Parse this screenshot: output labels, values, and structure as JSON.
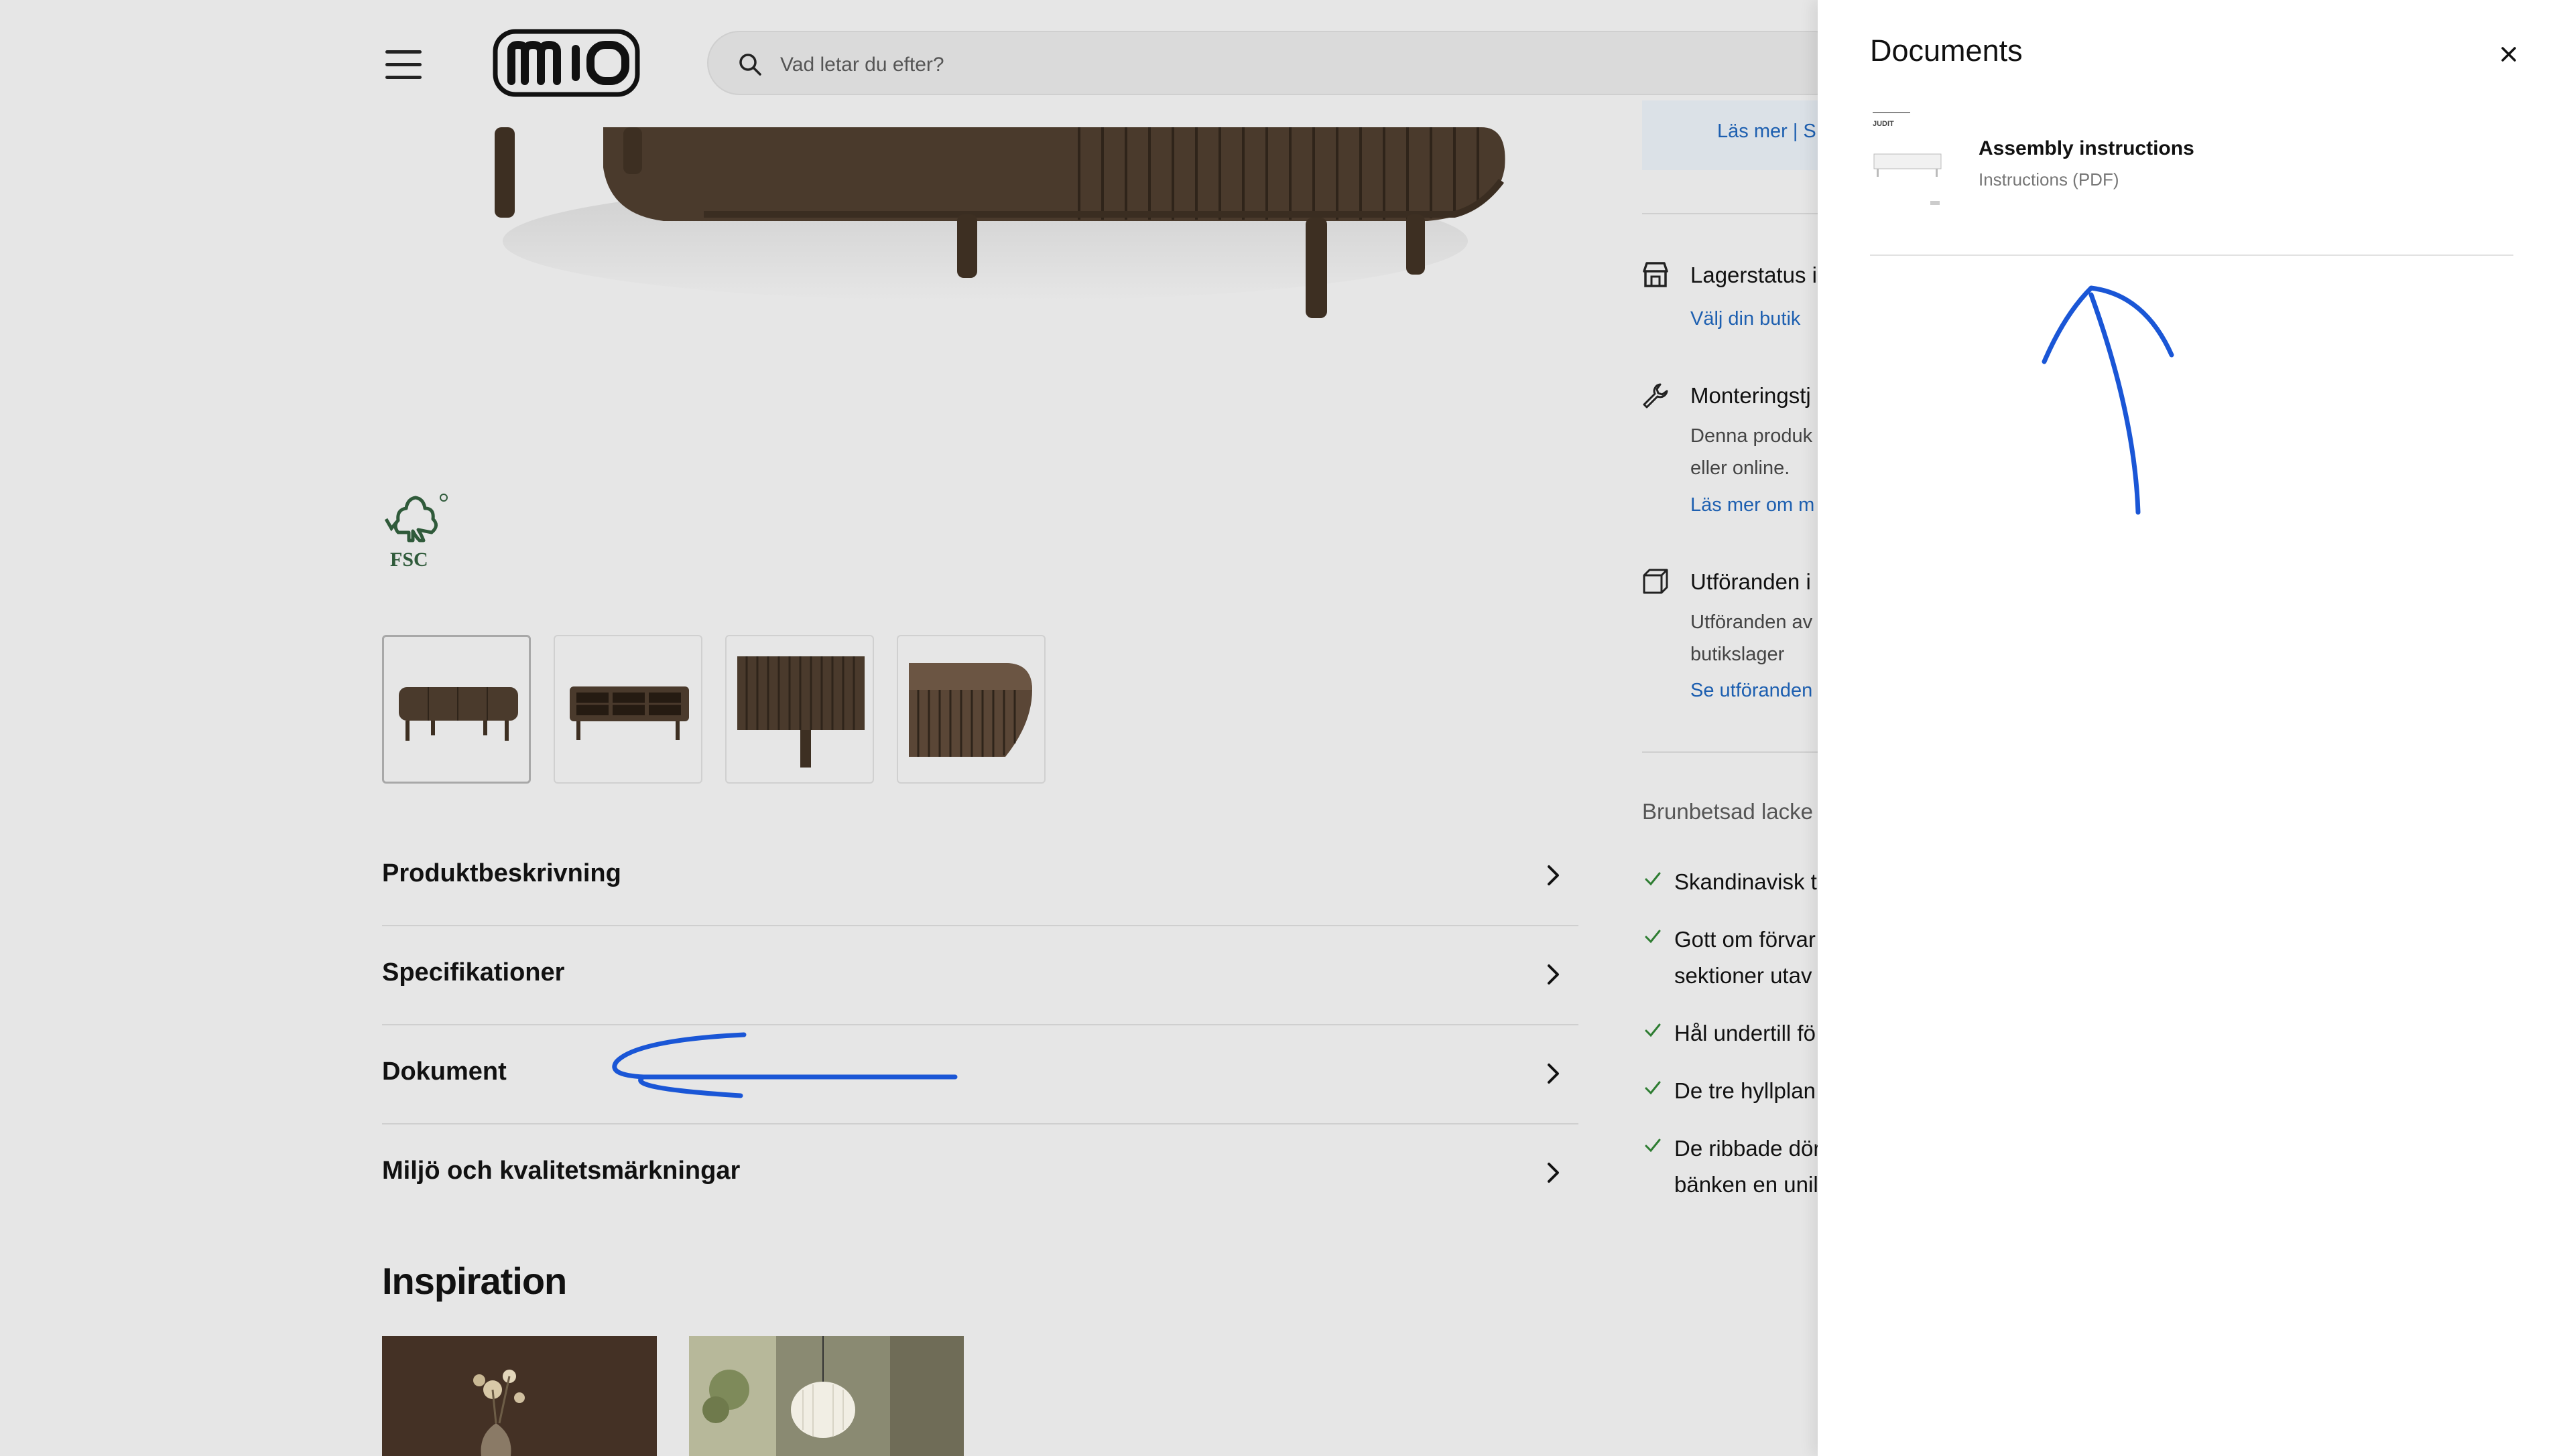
{
  "header": {
    "search_placeholder": "Vad letar du efter?"
  },
  "gallery": {
    "thumbnails": [
      {
        "label": "sideboard-front"
      },
      {
        "label": "sideboard-open"
      },
      {
        "label": "sideboard-detail"
      },
      {
        "label": "sideboard-corner"
      }
    ]
  },
  "accordion": {
    "items": [
      {
        "label": "Produktbeskrivning"
      },
      {
        "label": "Specifikationer"
      },
      {
        "label": "Dokument"
      },
      {
        "label": "Miljö och kvalitetsmärkningar"
      }
    ]
  },
  "inspiration": {
    "title": "Inspiration"
  },
  "right_column": {
    "banner_link": "Läs mer  |  S",
    "stock": {
      "title": "Lagerstatus i",
      "link": "Välj din butik"
    },
    "assembly": {
      "title": "Monteringstj",
      "line1": "Denna produk",
      "line2": "eller online.",
      "link": "Läs mer om m"
    },
    "variants": {
      "title": "Utföranden i",
      "line1": "Utföranden av",
      "line2": "butikslager",
      "link": "Se utföranden"
    },
    "description": "Brunbetsad lacke",
    "features": [
      {
        "line1": "Skandinavisk t"
      },
      {
        "line1": "Gott om förvar",
        "line2": "sektioner utav"
      },
      {
        "line1": "Hål undertill fö"
      },
      {
        "line1": "De tre hyllplan"
      },
      {
        "line1": "De ribbade dör",
        "line2": "bänken en unil"
      }
    ]
  },
  "drawer": {
    "title": "Documents",
    "documents": [
      {
        "title": "Assembly instructions",
        "subtitle": "Instructions (PDF)",
        "thumb_caption": "JUDIT"
      }
    ]
  },
  "colors": {
    "page_bg": "#e6e6e6",
    "link": "#1d5fb0",
    "check": "#2e7d32",
    "annotation": "#1a56d6",
    "fsc_green": "#2f5a3a"
  }
}
